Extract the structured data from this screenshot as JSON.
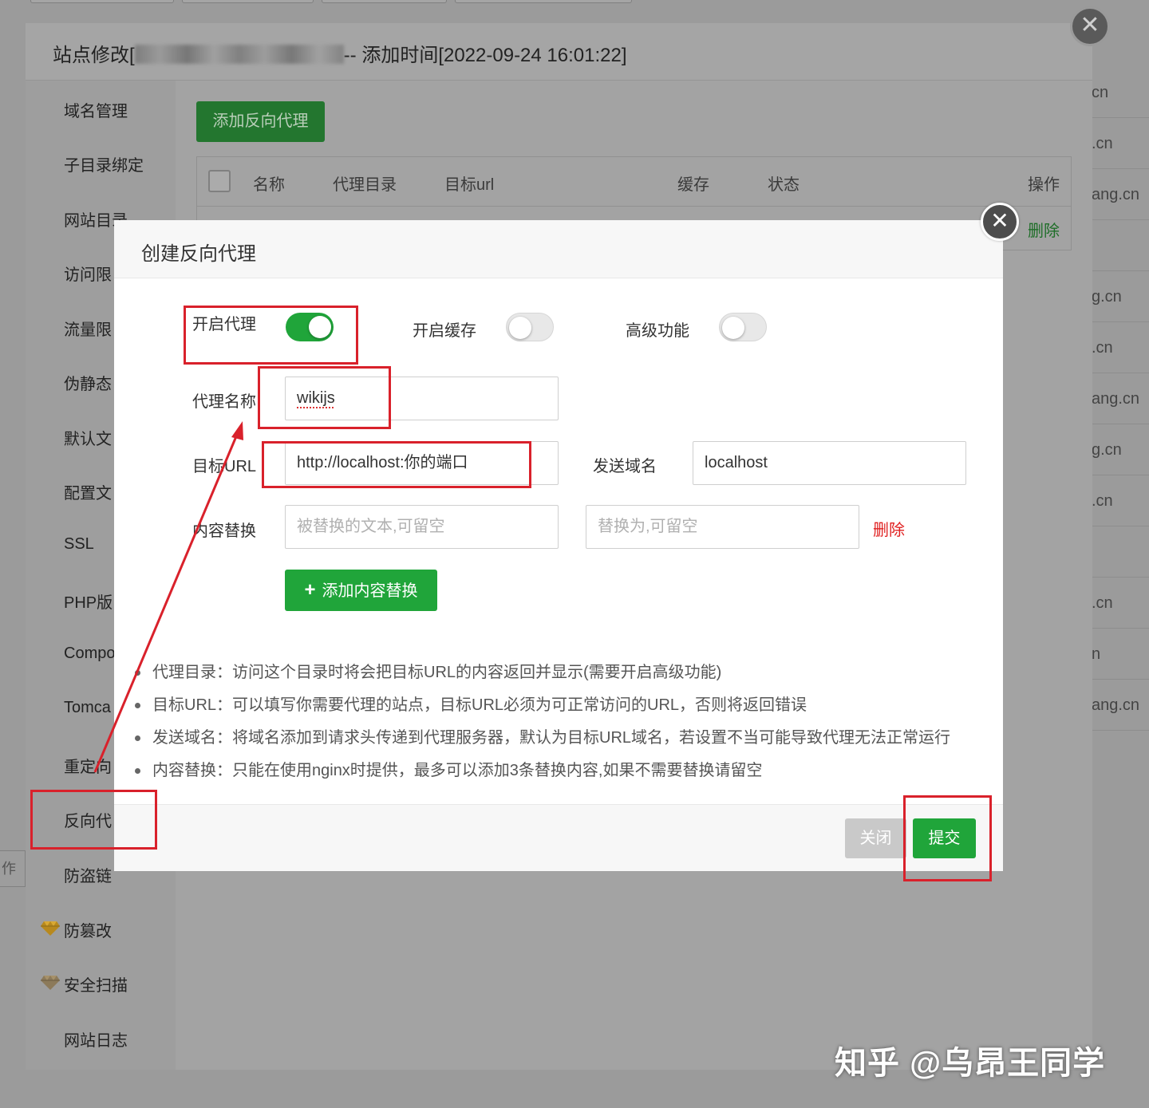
{
  "background": {
    "right_list": [
      "cn",
      ".cn",
      "ang.cn",
      "",
      "g.cn",
      ".cn",
      "ang.cn",
      "g.cn",
      ".cn",
      "",
      ".cn",
      "n",
      "ang.cn"
    ],
    "left_fragment": "作"
  },
  "site_modal": {
    "title_prefix": "站点修改[",
    "title_suffix": "-- 添加时间[2022-09-24 16:01:22]",
    "close_icon": "close-icon",
    "sidebar": [
      {
        "label": "域名管理"
      },
      {
        "label": "子目录绑定"
      },
      {
        "label": "网站目录"
      },
      {
        "label": "访问限"
      },
      {
        "label": "流量限"
      },
      {
        "label": "伪静态"
      },
      {
        "label": "默认文"
      },
      {
        "label": "配置文"
      },
      {
        "label": "SSL"
      },
      {
        "label": "PHP版"
      },
      {
        "label": "Compo"
      },
      {
        "label": "Tomca"
      },
      {
        "label": "重定向"
      },
      {
        "label": "反向代"
      },
      {
        "label": "防盗链"
      },
      {
        "label": "防篡改",
        "icon": "diamond-icon"
      },
      {
        "label": "安全扫描",
        "icon": "diamond-icon"
      },
      {
        "label": "网站日志"
      }
    ],
    "add_proxy_button": "添加反向代理",
    "table": {
      "columns": [
        "名称",
        "代理目录",
        "目标url",
        "缓存",
        "状态",
        "操作"
      ],
      "row_action": "删除"
    }
  },
  "dialog": {
    "title": "创建反向代理",
    "close_icon": "close-icon",
    "enable_proxy": {
      "label": "开启代理",
      "on": true
    },
    "enable_cache": {
      "label": "开启缓存",
      "on": false
    },
    "advanced": {
      "label": "高级功能",
      "on": false
    },
    "proxy_name": {
      "label": "代理名称",
      "value": "wikijs"
    },
    "target_url": {
      "label": "目标URL",
      "value": "http://localhost:你的端口"
    },
    "send_domain": {
      "label": "发送域名",
      "value": "localhost"
    },
    "content_replace": {
      "label": "内容替换",
      "placeholder_from": "被替换的文本,可留空",
      "placeholder_to": "替换为,可留空",
      "delete": "删除"
    },
    "add_content_button": "添加内容替换",
    "help": [
      "代理目录：访问这个目录时将会把目标URL的内容返回并显示(需要开启高级功能)",
      "目标URL：可以填写你需要代理的站点，目标URL必须为可正常访问的URL，否则将返回错误",
      "发送域名：将域名添加到请求头传递到代理服务器，默认为目标URL域名，若设置不当可能导致代理无法正常运行",
      "内容替换：只能在使用nginx时提供，最多可以添加3条替换内容,如果不需要替换请留空"
    ],
    "footer": {
      "close": "关闭",
      "submit": "提交"
    }
  },
  "annotation_color": "#d9212b",
  "accent_color": "#20a53a",
  "watermark": "知乎 @乌昂王同学"
}
